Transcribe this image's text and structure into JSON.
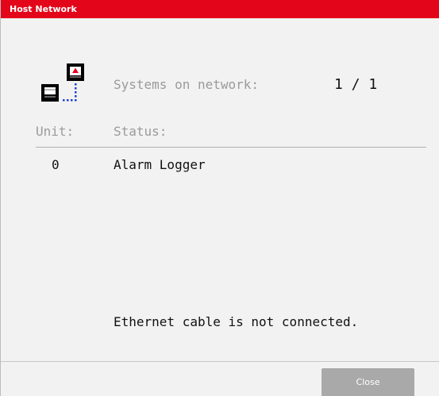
{
  "window": {
    "title": "Host Network"
  },
  "summary": {
    "icon": "network-systems-icon",
    "systems_label": "Systems on network:",
    "systems_count": "1 / 1"
  },
  "table": {
    "columns": {
      "unit": "Unit:",
      "status": "Status:"
    },
    "rows": [
      {
        "unit": "0",
        "status": "Alarm Logger"
      }
    ]
  },
  "connection_message": "Ethernet cable is not connected.",
  "footer": {
    "close_label": "Close"
  },
  "colors": {
    "title_bar": "#e3061a",
    "background": "#f2f2f2",
    "button": "#a9a9a9",
    "icon_link": "#1e3fd6"
  }
}
